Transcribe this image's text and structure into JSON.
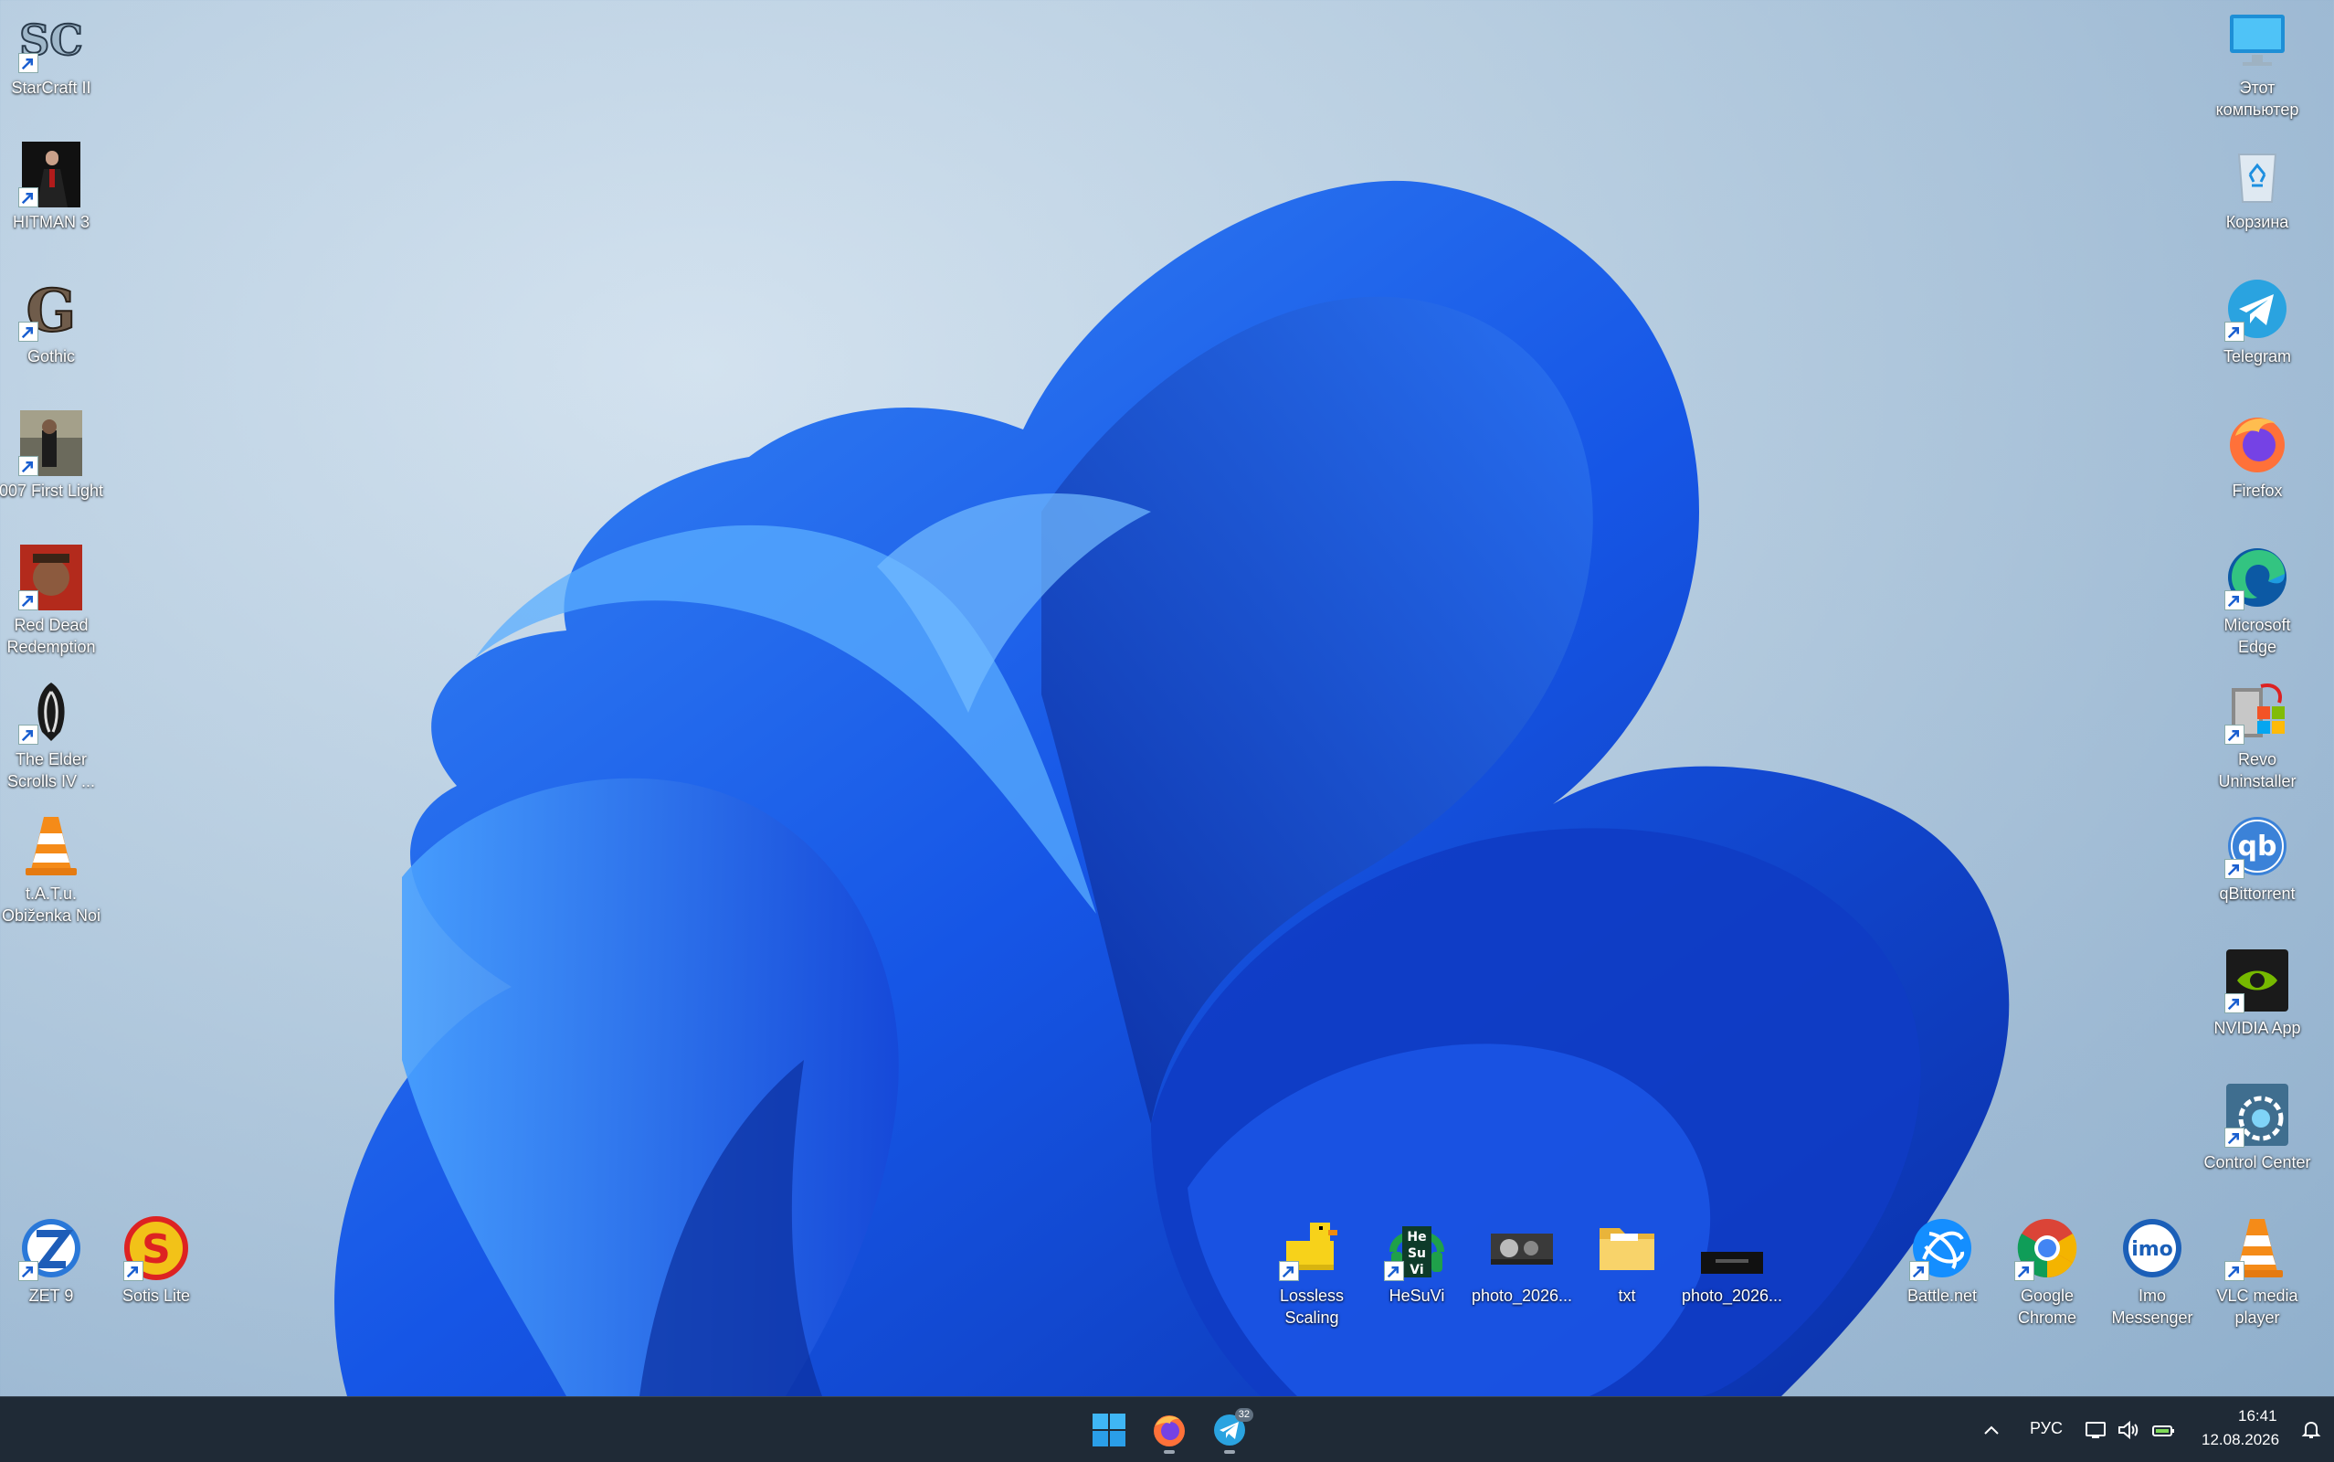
{
  "desktop": {
    "left_icons": [
      {
        "label": "StarCraft II",
        "icon": "starcraft-icon"
      },
      {
        "label": "HITMAN 3",
        "icon": "hitman-icon"
      },
      {
        "label": "Gothic",
        "icon": "gothic-icon"
      },
      {
        "label": "007 First Light",
        "icon": "007-icon"
      },
      {
        "label": "Red Dead Redemption",
        "icon": "red-dead-icon"
      },
      {
        "label": "The Elder Scrolls IV ...",
        "icon": "oblivion-icon"
      },
      {
        "label": "t.A.T.u. Obiženka Noi",
        "icon": "vlc-file-icon"
      }
    ],
    "right_icons": [
      {
        "label": "Этот компьютер",
        "icon": "this-pc-icon"
      },
      {
        "label": "Корзина",
        "icon": "recycle-bin-icon"
      },
      {
        "label": "Telegram",
        "icon": "telegram-icon"
      },
      {
        "label": "Firefox",
        "icon": "firefox-icon"
      },
      {
        "label": "Microsoft Edge",
        "icon": "edge-icon"
      },
      {
        "label": "Revo Uninstaller",
        "icon": "revo-uninstaller-icon"
      },
      {
        "label": "qBittorrent",
        "icon": "qbittorrent-icon"
      },
      {
        "label": "NVIDIA App",
        "icon": "nvidia-icon"
      },
      {
        "label": "Control Center",
        "icon": "control-center-icon"
      }
    ],
    "bottom_left_icons": [
      {
        "label": "ZET 9",
        "icon": "zet9-icon"
      },
      {
        "label": "Sotis Lite",
        "icon": "sotis-lite-icon"
      }
    ],
    "bottom_middle_icons": [
      {
        "label": "Lossless Scaling",
        "icon": "duck-icon"
      },
      {
        "label": "HeSuVi",
        "icon": "hesuvi-icon"
      },
      {
        "label": "photo_2026...",
        "icon": "photo-thumbnail-icon"
      },
      {
        "label": "txt",
        "icon": "folder-icon"
      },
      {
        "label": "photo_2026...",
        "icon": "photo-thumbnail-icon"
      }
    ],
    "bottom_right_icons": [
      {
        "label": "Battle.net",
        "icon": "battlenet-icon"
      },
      {
        "label": "Google Chrome",
        "icon": "chrome-icon"
      },
      {
        "label": "Imo Messenger",
        "icon": "imo-icon"
      },
      {
        "label": "VLC media player",
        "icon": "vlc-icon"
      }
    ]
  },
  "taskbar": {
    "apps": [
      {
        "name": "start",
        "icon": "windows-start-icon"
      },
      {
        "name": "firefox",
        "icon": "firefox-icon"
      },
      {
        "name": "telegram",
        "icon": "telegram-icon",
        "badge": "32"
      }
    ],
    "tray": {
      "language": "РУС",
      "time": "16:41",
      "date": "12.08.2026"
    }
  },
  "colors": {
    "taskbar_bg": "#1f2a36",
    "wallpaper_bloom": "#1a5cf0"
  }
}
